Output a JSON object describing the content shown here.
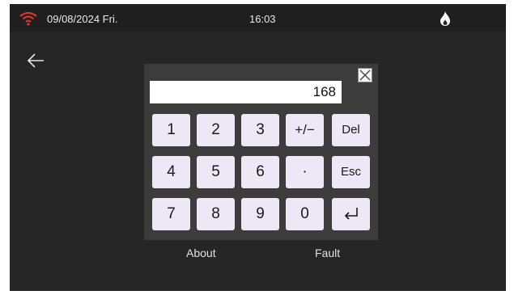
{
  "status_bar": {
    "date": "09/08/2024 Fri.",
    "time": "16:03",
    "wifi_icon": "wifi-icon",
    "flame_icon": "flame-icon",
    "wifi_color": "#d9372e"
  },
  "navigation": {
    "back_icon": "arrow-left-icon"
  },
  "keypad": {
    "display_value": "168",
    "close_icon": "close-icon",
    "keys": {
      "k1": "1",
      "k2": "2",
      "k3": "3",
      "plusminus": "+/−",
      "del": "Del",
      "k4": "4",
      "k5": "5",
      "k6": "6",
      "dot": "·",
      "esc": "Esc",
      "k7": "7",
      "k8": "8",
      "k9": "9",
      "k0": "0",
      "enter_icon": "enter-icon"
    }
  },
  "bottom_menu": {
    "about": "About",
    "fault": "Fault"
  }
}
